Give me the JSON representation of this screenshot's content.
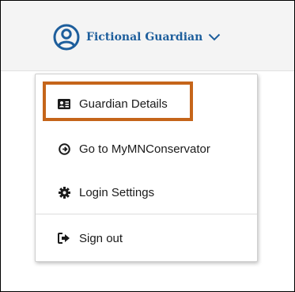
{
  "header": {
    "user_name": "Fictional Guardian",
    "avatar_icon": "user-circle-icon",
    "expand_icon": "chevron-down-icon",
    "brand_color": "#1d5e9c"
  },
  "menu": {
    "items": [
      {
        "label": "Guardian Details",
        "icon": "id-card-icon"
      },
      {
        "label": "Go to MyMNConservator",
        "icon": "circle-arrow-right-icon"
      },
      {
        "label": "Login Settings",
        "icon": "gear-icon"
      },
      {
        "label": "Sign out",
        "icon": "sign-out-icon"
      }
    ],
    "highlighted_item": "Guardian Details",
    "highlight_color": "#c5651a"
  }
}
